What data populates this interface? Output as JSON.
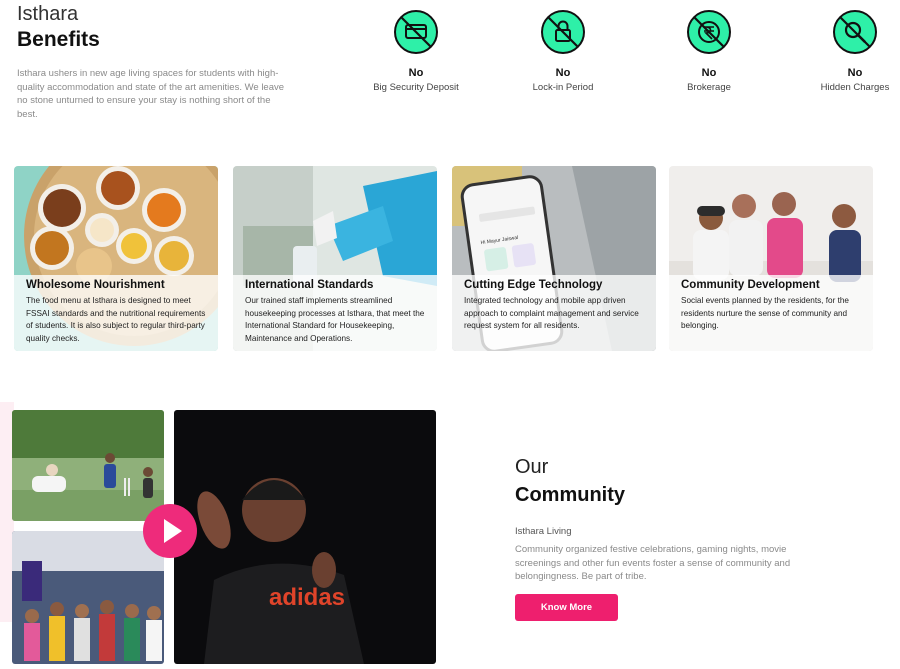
{
  "benefits": {
    "title_light": "Isthara",
    "title_bold": "Benefits",
    "description": "Isthara ushers in new age living spaces for students with high-quality accommodation and state of the art amenities. We leave no stone unturned to ensure your stay is nothing short of the best.",
    "perks": [
      {
        "icon": "card-payment-icon",
        "no": "No",
        "label": "Big Security Deposit"
      },
      {
        "icon": "lock-icon",
        "no": "No",
        "label": "Lock-in Period"
      },
      {
        "icon": "rupee-icon",
        "no": "No",
        "label": "Brokerage"
      },
      {
        "icon": "search-icon",
        "no": "No",
        "label": "Hidden Charges"
      }
    ],
    "accent_color": "#2ef0a8"
  },
  "features": [
    {
      "title": "Wholesome Nourishment",
      "description": "The food menu at Isthara is designed to meet FSSAI standards and the nutritional requirements of students. It is also subject to regular third-party quality checks."
    },
    {
      "title": "International Standards",
      "description": "Our trained staff implements streamlined housekeeping processes at Isthara, that meet the International Standard for Housekeeping, Maintenance and Operations."
    },
    {
      "title": "Cutting Edge Technology",
      "description": "Integrated technology and mobile app driven approach to complaint management and service request system for all residents."
    },
    {
      "title": "Community Development",
      "description": "Social events planned by the residents, for the residents nurture the sense of community and belonging."
    }
  ],
  "phone_screen": {
    "greeting": "Hi Mayur Jaiswal"
  },
  "community": {
    "title_light": "Our",
    "title_bold": "Community",
    "subtitle": "Isthara Living",
    "description": "Community organized festive celebrations, gaming nights, movie screenings and other fun events foster a sense of community and belongingness. Be part of tribe.",
    "button_label": "Know More",
    "shirt_text": "adidas",
    "button_color": "#ee1f6e"
  }
}
